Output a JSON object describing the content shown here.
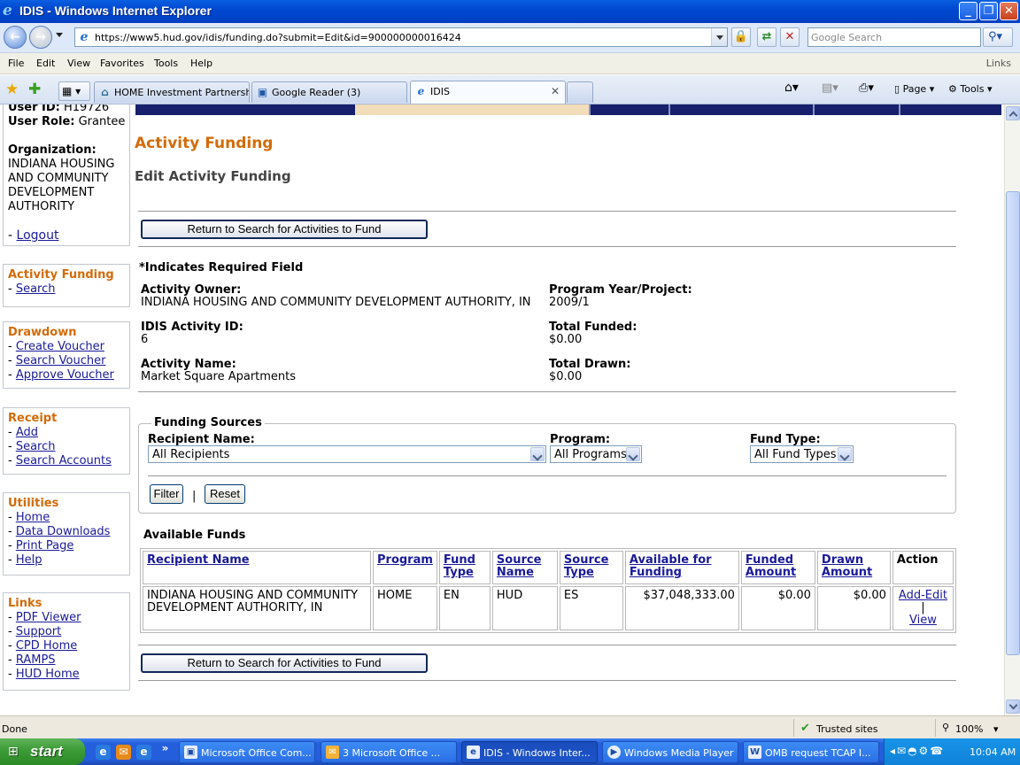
{
  "window": {
    "title": "IDIS - Windows Internet Explorer",
    "minimize": "_",
    "restore": "❐",
    "close": "✕"
  },
  "address": {
    "url": "https://www5.hud.gov/idis/funding.do?submit=Edit&id=900000000016424",
    "search_placeholder": "Google Search"
  },
  "menu": {
    "items": [
      "File",
      "Edit",
      "View",
      "Favorites",
      "Tools",
      "Help"
    ],
    "links": "Links"
  },
  "tabs": [
    {
      "label": "HOME Investment Partnershi..."
    },
    {
      "label": "Google Reader (3)"
    },
    {
      "label": "IDIS"
    }
  ],
  "commands": {
    "page": "Page",
    "tools": "Tools"
  },
  "sidebar": {
    "user_id_label": "User ID:",
    "user_id": "H19726",
    "role_label": "User Role:",
    "role": "Grantee",
    "org_label": "Organization:",
    "org_lines": [
      "INDIANA HOUSING",
      "AND COMMUNITY",
      "DEVELOPMENT",
      "AUTHORITY"
    ],
    "logout": "Logout",
    "sections": [
      {
        "title": "Activity Funding",
        "links": [
          "Search"
        ]
      },
      {
        "title": "Drawdown",
        "links": [
          "Create Voucher",
          "Search Voucher",
          "Approve Voucher"
        ]
      },
      {
        "title": "Receipt",
        "links": [
          "Add",
          "Search",
          "Search Accounts"
        ]
      },
      {
        "title": "Utilities",
        "links": [
          "Home",
          "Data Downloads",
          "Print Page",
          "Help"
        ]
      },
      {
        "title": "Links",
        "links": [
          "PDF Viewer",
          "Support",
          "CPD Home",
          "RAMPS",
          "HUD Home"
        ]
      }
    ]
  },
  "page": {
    "title": "Activity Funding",
    "subtitle": "Edit Activity Funding",
    "return_button": "Return to Search for Activities to Fund",
    "required_note": "*Indicates Required Field",
    "activity_owner_label": "Activity Owner:",
    "activity_owner": "INDIANA HOUSING AND COMMUNITY DEVELOPMENT AUTHORITY, IN",
    "program_year_label": "Program Year/Project:",
    "program_year": "2009/1",
    "activity_id_label": "IDIS Activity ID:",
    "activity_id": "6",
    "total_funded_label": "Total Funded:",
    "total_funded": "$0.00",
    "activity_name_label": "Activity Name:",
    "activity_name": "Market Square Apartments",
    "total_drawn_label": "Total Drawn:",
    "total_drawn": "$0.00"
  },
  "funding_sources": {
    "legend": "Funding Sources",
    "recipient_label": "Recipient Name:",
    "recipient_value": "All Recipients",
    "program_label": "Program:",
    "program_value": "All Programs",
    "fund_type_label": "Fund Type:",
    "fund_type_value": "All Fund Types",
    "filter": "Filter",
    "separator": "|",
    "reset": "Reset"
  },
  "available_funds": {
    "heading": "Available Funds",
    "columns": [
      "Recipient Name",
      "Program",
      "Fund Type",
      "Source Name",
      "Source Type",
      "Available for Funding",
      "Funded Amount",
      "Drawn Amount",
      "Action"
    ],
    "rows": [
      {
        "recipient": "INDIANA HOUSING AND COMMUNITY DEVELOPMENT AUTHORITY, IN",
        "program": "HOME",
        "fund_type": "EN",
        "source_name": "HUD",
        "source_type": "ES",
        "available": "$37,048,333.00",
        "funded": "$0.00",
        "drawn": "$0.00",
        "action_edit": "Add-Edit",
        "action_sep": "|",
        "action_view": "View"
      }
    ]
  },
  "status": {
    "text": "Done",
    "zone": "Trusted sites",
    "zoom": "100%"
  },
  "taskbar": {
    "start": "start",
    "items": [
      {
        "label": "Microsoft Office Com..."
      },
      {
        "label": "3 Microsoft Office ..."
      },
      {
        "label": "IDIS - Windows Inter..."
      },
      {
        "label": "Windows Media Player"
      },
      {
        "label": "OMB request TCAP I..."
      }
    ],
    "clock": "10:04 AM"
  }
}
